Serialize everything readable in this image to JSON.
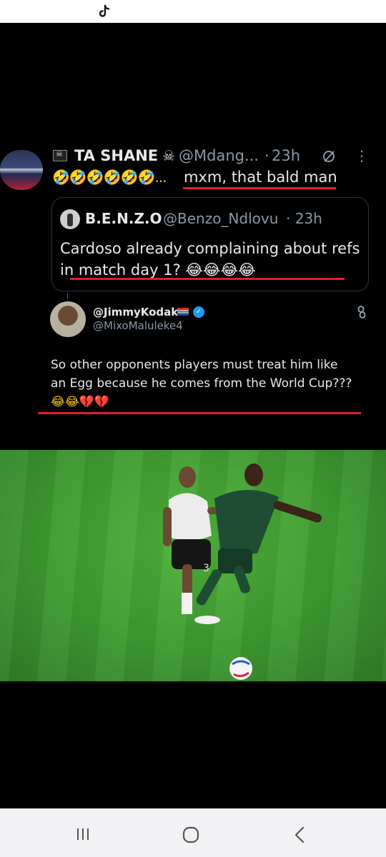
{
  "status_bar": {
    "app_icon": "tiktok-icon"
  },
  "tweet": {
    "display_name": "TA SHANE",
    "handle": "@Mdang...",
    "separator": "·",
    "time": "23h",
    "emojis": "🤣🤣🤣🤣🤣🤣...",
    "text": "mxm, that bald man",
    "name_icons": [
      "pirate-flag-icon",
      "skull-crossbones-icon"
    ],
    "action_icons": [
      "grok-icon",
      "more-vertical-icon"
    ]
  },
  "quoted_tweet": {
    "display_name": "B.E.N.Z.O",
    "handle": "@Benzo_Ndlovu",
    "time": "· 23h",
    "line1": "Cardoso already complaining about refs",
    "line2": "in match day 1? 😂😂😂😂"
  },
  "reply_card": {
    "display_name": "@JimmyKodak",
    "handle": "@MixoMaluleke4",
    "line1": "So other opponents players must treat him like",
    "line2": "an Egg because he comes from the World Cup???",
    "emojis": "😂😂💔💔",
    "icons": [
      "south-africa-flag-icon",
      "verified-badge-icon",
      "link-icon"
    ]
  },
  "photo": {
    "jersey_number": "3"
  },
  "accent_color": "#e11d2a",
  "nav_bar": {
    "icons": [
      "recents-icon",
      "home-icon",
      "back-icon"
    ]
  }
}
